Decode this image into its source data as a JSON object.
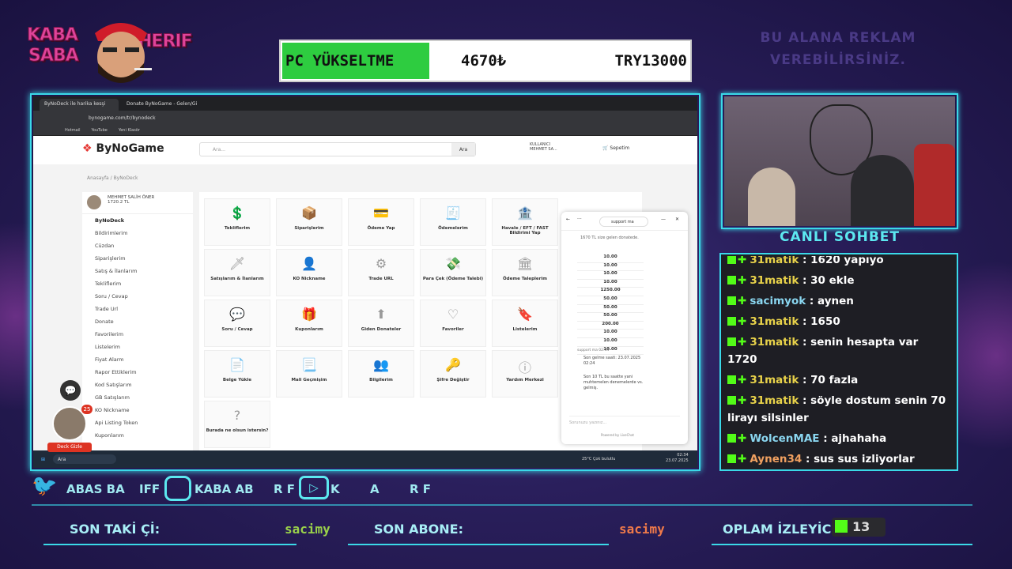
{
  "overlay": {
    "logo_line1": "KABA",
    "logo_line2": "SABA",
    "logo_line3": "HERIF",
    "goal_title": "PC YÜKSELTME",
    "goal_current": "4670₺",
    "goal_target": "TRY13000",
    "goal_progress": 0.36,
    "ad_text_1": "BU ALANA REKLAM",
    "ad_text_2": "VEREBİLİRSİNİZ.",
    "chat_title": "CANLI SOHBET",
    "social_twitter": "ABAS  BA",
    "social_twitter2": "IFF",
    "social_instagram": "KABA  AB",
    "social_instagram2": "R F",
    "social_youtube": "K",
    "social_youtube2": "A",
    "social_youtube3": "R F",
    "last_follower_label": "SON TAKİ  Çİ:",
    "last_follower_value": "sacimy",
    "last_sub_label": "SON ABONE:",
    "last_sub_value": "sacimy",
    "viewers_label": "OPLAM İZLEYİCİ:",
    "viewers_count": "13",
    "deck_badge": "Deck Gizle",
    "notif_count": "25"
  },
  "browser": {
    "tab1": "ByNoDeck ile harika kesşi",
    "tab2": "Donate ByNoGame - Gelen/Gi",
    "url": "bynogame.com/tr/bynodeck",
    "bookmarks": [
      "Hotmail",
      "YouTube",
      "Yeni Klasör"
    ]
  },
  "site": {
    "brand": "ByNoGame",
    "search_placeholder": "Ara...",
    "search_button": "Ara",
    "user_name": "MEHMET SA...",
    "user_label": "KULLANICI",
    "cart": "Sepetim",
    "breadcrumb": "Anasayfa  /  ByNoDeck",
    "profile_name": "MEHMET SALİH ÖNER",
    "profile_balance": "1720.2 TL",
    "sidebar": [
      "ByNoDeck",
      "Bildirimlerim",
      "Cüzdan",
      "Siparişlerim",
      "Satış & İlanlarım",
      "Tekliflerim",
      "Soru / Cevap",
      "Trade Url",
      "Donate",
      "Favorilerim",
      "Listelerim",
      "Fiyat Alarm",
      "Rapor Ettiklerim",
      "Kod Satışlarım",
      "GB Satışlarım",
      "KO Nickname",
      "Api Listing Token",
      "Kuponlarım"
    ],
    "cards": [
      "Tekliflerim",
      "Siparişlerim",
      "Ödeme Yap",
      "Ödemelerim",
      "Havale / EFT / FAST Bildirimi Yap",
      "Satışlarım & İlanlarım",
      "KO Nickname",
      "Trade URL",
      "Para Çek (Ödeme Talebi)",
      "Ödeme Taleplerim",
      "Soru / Cevap",
      "Kuponlarım",
      "Giden Donateler",
      "Favoriler",
      "Listelerim",
      "Belge Yükle",
      "Mali Geçmişim",
      "Bilgilerim",
      "Şifre Değiştir",
      "Yardım Merkezi",
      "Burada ne olsun istersin?"
    ],
    "livechat_agent": "support ma",
    "livechat_intro": "1670 TL size gelen donatede.",
    "livechat_values": [
      "10.00",
      "10.00",
      "10.00",
      "10.00",
      "1250.00",
      "50.00",
      "50.00",
      "50.00",
      "200.00",
      "10.00",
      "10.00",
      "10.00"
    ],
    "livechat_sender": "support ma 02:34",
    "livechat_msg1": "Son gelme saati: 23.07.2025 02:24",
    "livechat_msg2": "Son 10 TL bu saatte yani muhtemelen denemelerde vs. gelmiş.",
    "livechat_placeholder": "Sorunuzu yazınız...",
    "livechat_powered": "Powered by LiveChat",
    "taskbar_search": "Ara",
    "weather": "25°C Çok bulutlu",
    "clock_time": "02:34",
    "clock_date": "23.07.2025"
  },
  "chat": [
    {
      "user": "31matik",
      "text": "1620 yapıyo",
      "color": "u"
    },
    {
      "user": "31matik",
      "text": "30 ekle",
      "color": "u"
    },
    {
      "user": "sacimyok",
      "text": "aynen",
      "color": "u2"
    },
    {
      "user": "31matik",
      "text": "1650",
      "color": "u"
    },
    {
      "user": "31matik",
      "text": "senin hesapta var 1720",
      "color": "u"
    },
    {
      "user": "31matik",
      "text": "70 fazla",
      "color": "u"
    },
    {
      "user": "31matik",
      "text": "söyle dostum senin 70 lirayı silsinler",
      "color": "u"
    },
    {
      "user": "WolcenMAE",
      "text": "ajhahaha",
      "color": "u2"
    },
    {
      "user": "Aynen34",
      "text": "sus sus izliyorlar rjfjfjdjjsjbs",
      "color": "u3"
    }
  ],
  "colors": {
    "accent": "#3ad9e8",
    "kick_green": "#53fc18",
    "goal_green": "#2ecc40"
  }
}
